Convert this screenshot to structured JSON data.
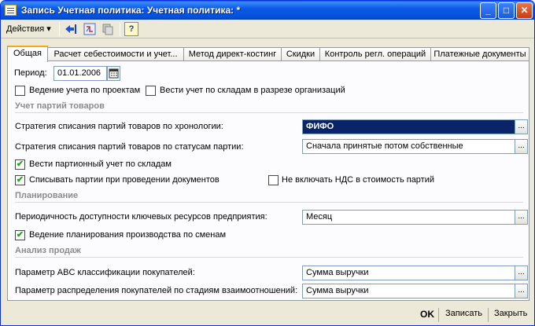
{
  "window": {
    "title": "Запись Учетная политика: Учетная политика: *"
  },
  "titlebar_buttons": {
    "minimize": "_",
    "maximize": "□",
    "close": "✕"
  },
  "toolbar": {
    "actions": "Действия ▾",
    "help": "?"
  },
  "tabs": [
    {
      "label": "Общая"
    },
    {
      "label": "Расчет себестоимости и учет..."
    },
    {
      "label": "Метод директ-костинг"
    },
    {
      "label": "Скидки"
    },
    {
      "label": "Контроль регл. операций"
    },
    {
      "label": "Платежные документы"
    }
  ],
  "form": {
    "period_label": "Период:",
    "period_value": "01.01.2006",
    "cb_projects": "Ведение учета по проектам",
    "cb_warehouses": "Вести учет по складам в разрезе организаций",
    "section_batches": "Учет партий товаров",
    "strategy_chrono_label": "Стратегия списания партий товаров по хронологии:",
    "strategy_chrono_value": "ФИФО",
    "strategy_status_label": "Стратегия списания партий товаров по статусам партии:",
    "strategy_status_value": "Сначала принятые потом собственные",
    "cb_batch_warehouse": "Вести партионный учет по складам",
    "cb_writeoff": "Списывать партии при проведении документов",
    "cb_vat": "Не включать НДС в стоимость партий",
    "section_planning": "Планирование",
    "periodicity_label": "Периодичность доступности ключевых ресурсов предприятия:",
    "periodicity_value": "Месяц",
    "cb_shifts": "Ведение планирования производства по сменам",
    "section_sales": "Анализ продаж",
    "abc_label": "Параметр ABC классификации покупателей:",
    "abc_value": "Сумма выручки",
    "stages_label": "Параметр распределения покупателей по стадиям взаимоотношений:",
    "stages_value": "Сумма выручки",
    "dots": "..."
  },
  "checkmark": "✔",
  "buttons": {
    "ok": "OK",
    "save": "Записать",
    "close": "Закрыть"
  }
}
